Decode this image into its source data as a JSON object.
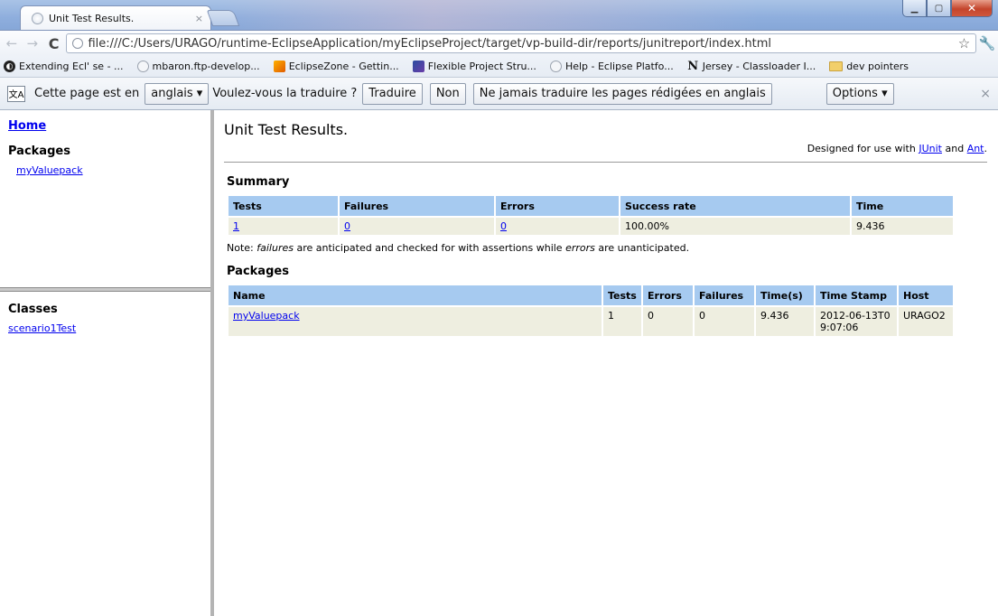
{
  "window": {
    "tab_title": "Unit Test Results.",
    "tab_close": "×",
    "minimize": "▁",
    "maximize": "▢",
    "close": "✕"
  },
  "toolbar": {
    "back": "←",
    "forward": "→",
    "reload": "C",
    "url": "file:///C:/Users/URAGO/runtime-EclipseApplication/myEclipseProject/target/vp-build-dir/reports/junitreport/index.html",
    "star": "☆",
    "wrench": "🔧"
  },
  "bookmarks": [
    {
      "label": "Extending Ecl' se - ...",
      "icon": "dark-circle-icon"
    },
    {
      "label": "mbaron.ftp-develop...",
      "icon": "globe-icon"
    },
    {
      "label": "EclipseZone - Gettin...",
      "icon": "eclipsezone-icon"
    },
    {
      "label": "Flexible Project Stru...",
      "icon": "eclipse-icon"
    },
    {
      "label": "Help - Eclipse Platfo...",
      "icon": "globe-icon"
    },
    {
      "label": "Jersey - Classloader I...",
      "icon": "n-letter-icon"
    },
    {
      "label": "dev pointers",
      "icon": "folder-icon"
    }
  ],
  "translate_bar": {
    "prefix": "Cette page est en",
    "language": "anglais ▾",
    "question": "Voulez-vous la traduire ?",
    "translate": "Traduire",
    "no": "Non",
    "never": "Ne jamais traduire les pages rédigées en anglais",
    "options": "Options ▾",
    "close": "×"
  },
  "sidebar": {
    "home": "Home",
    "packages_heading": "Packages",
    "packages": [
      "myValuepack"
    ],
    "classes_heading": "Classes",
    "classes": [
      "scenario1Test"
    ]
  },
  "main": {
    "title": "Unit Test Results.",
    "designed_prefix": "Designed for use with",
    "junit": "JUnit",
    "and": "and",
    "ant": "Ant",
    "period": ".",
    "summary_heading": "Summary",
    "summary_headers": [
      "Tests",
      "Failures",
      "Errors",
      "Success rate",
      "Time"
    ],
    "summary_row": [
      "1",
      "0",
      "0",
      "100.00%",
      "9.436"
    ],
    "note_prefix": "Note:",
    "note_failures": "failures",
    "note_middle": "are anticipated and checked for with assertions while",
    "note_errors": "errors",
    "note_suffix": "are unanticipated.",
    "packages_heading": "Packages",
    "packages_headers": [
      "Name",
      "Tests",
      "Errors",
      "Failures",
      "Time(s)",
      "Time Stamp",
      "Host"
    ],
    "packages_row": [
      "myValuepack",
      "1",
      "0",
      "0",
      "9.436",
      "2012-06-13T09:07:06",
      "URAGO2"
    ]
  }
}
